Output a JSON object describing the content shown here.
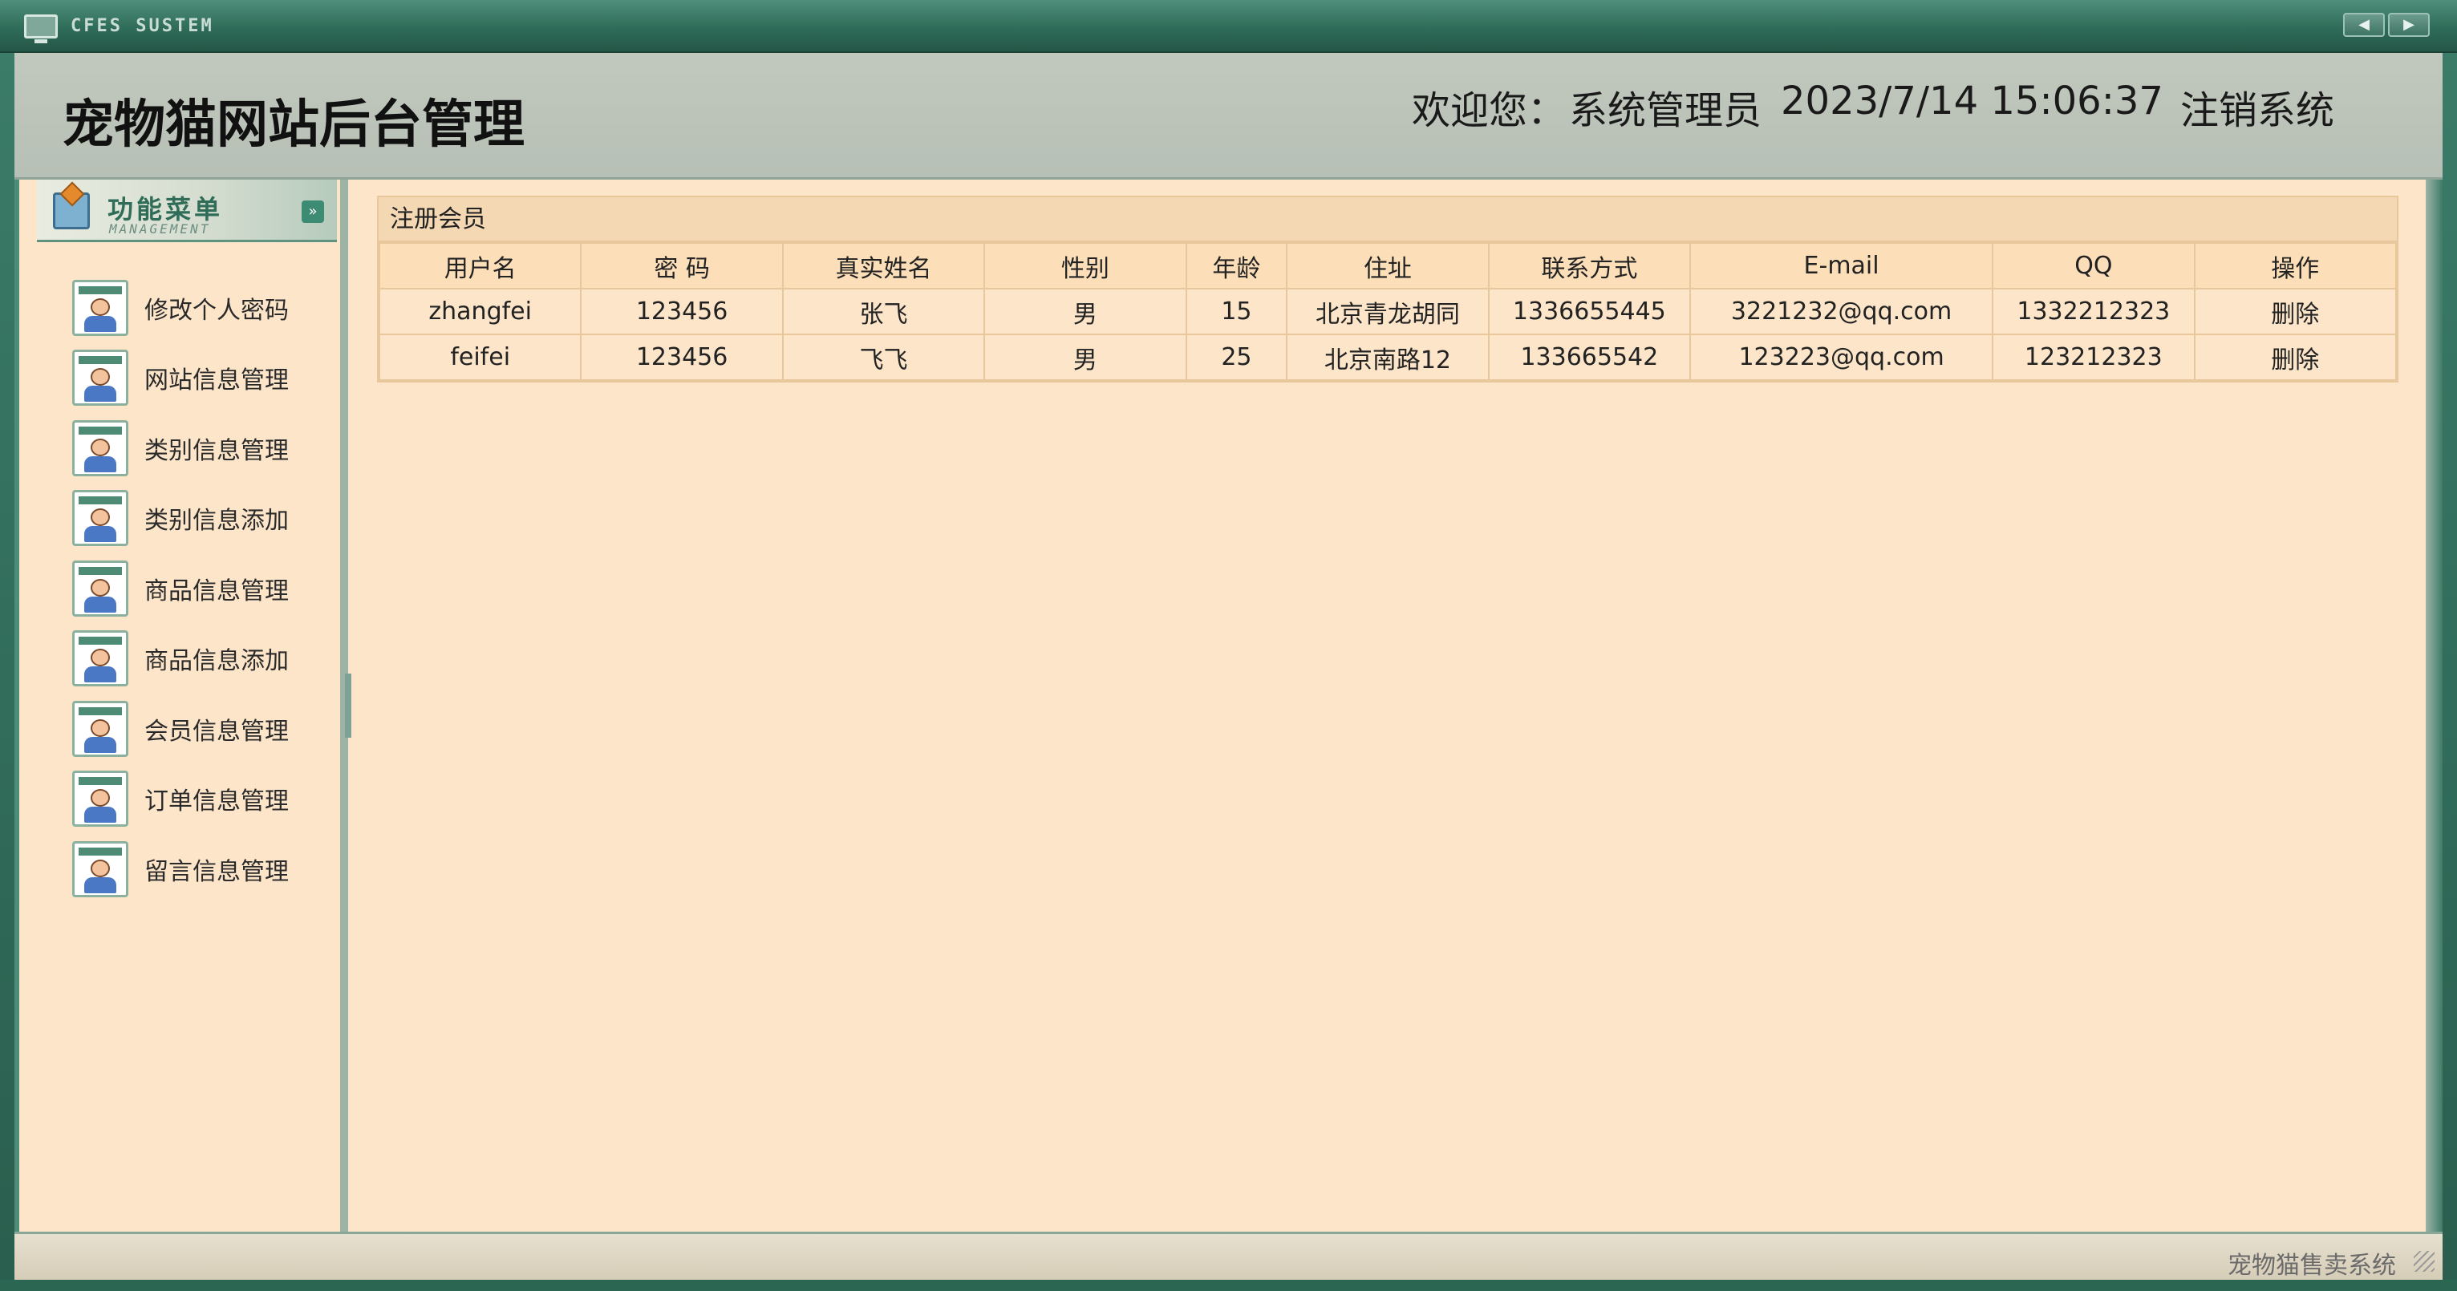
{
  "window": {
    "title": "CFES SUSTEM",
    "nav_prev": "◀",
    "nav_next": "▶"
  },
  "header": {
    "site_title": "宠物猫网站后台管理",
    "welcome_label": "欢迎您：",
    "user_name": "系统管理员",
    "datetime": "2023/7/14 15:06:37",
    "logout": "注销系统"
  },
  "sidebar": {
    "title": "功能菜单",
    "subtitle": "MANAGEMENT",
    "collapse_icon": "»",
    "items": [
      {
        "label": "修改个人密码",
        "icon": "user-icon"
      },
      {
        "label": "网站信息管理",
        "icon": "user-icon"
      },
      {
        "label": "类别信息管理",
        "icon": "user-icon"
      },
      {
        "label": "类别信息添加",
        "icon": "user-icon"
      },
      {
        "label": "商品信息管理",
        "icon": "user-icon"
      },
      {
        "label": "商品信息添加",
        "icon": "user-icon"
      },
      {
        "label": "会员信息管理",
        "icon": "user-icon"
      },
      {
        "label": "订单信息管理",
        "icon": "user-icon"
      },
      {
        "label": "留言信息管理",
        "icon": "user-icon"
      }
    ]
  },
  "panel": {
    "title": "注册会员",
    "columns": [
      "用户名",
      "密 码",
      "真实姓名",
      "性别",
      "年龄",
      "住址",
      "联系方式",
      "E-mail",
      "QQ",
      "操作"
    ],
    "rows": [
      [
        "zhangfei",
        "123456",
        "张飞",
        "男",
        "15",
        "北京青龙胡同",
        "1336655445",
        "3221232@qq.com",
        "1332212323",
        "删除"
      ],
      [
        "feifei",
        "123456",
        "飞飞",
        "男",
        "25",
        "北京南路12",
        "133665542",
        "123223@qq.com",
        "123212323",
        "删除"
      ]
    ]
  },
  "footer": {
    "text": "宠物猫售卖系统"
  },
  "colors": {
    "frame_green": "#2e6a58",
    "content_bg": "#fde5ca",
    "table_border": "#e7c79b",
    "header_bg": "#c1c8be"
  }
}
